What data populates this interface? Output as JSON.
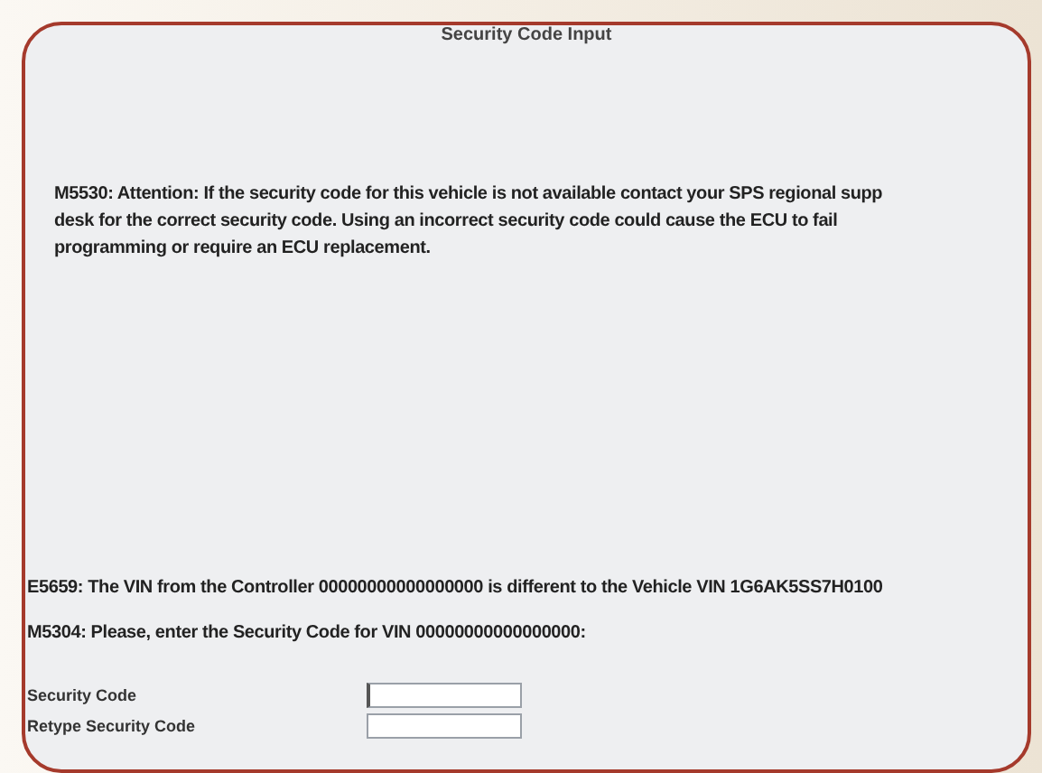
{
  "window": {
    "title": "Security Code Input"
  },
  "attention": {
    "lines": [
      "M5530: Attention: If the security code for this vehicle is not available contact your SPS regional supp",
      "desk for the correct security code. Using an incorrect security code could cause the ECU to fail",
      "programming or require an ECU replacement."
    ]
  },
  "messages": [
    "E5659: The VIN from the Controller 00000000000000000 is different to the Vehicle VIN 1G6AK5SS7H0100",
    "M5304: Please, enter the Security Code for VIN 00000000000000000:"
  ],
  "fields": [
    {
      "label": "Security Code",
      "focused": true
    },
    {
      "label": "Retype Security Code",
      "focused": false
    }
  ]
}
